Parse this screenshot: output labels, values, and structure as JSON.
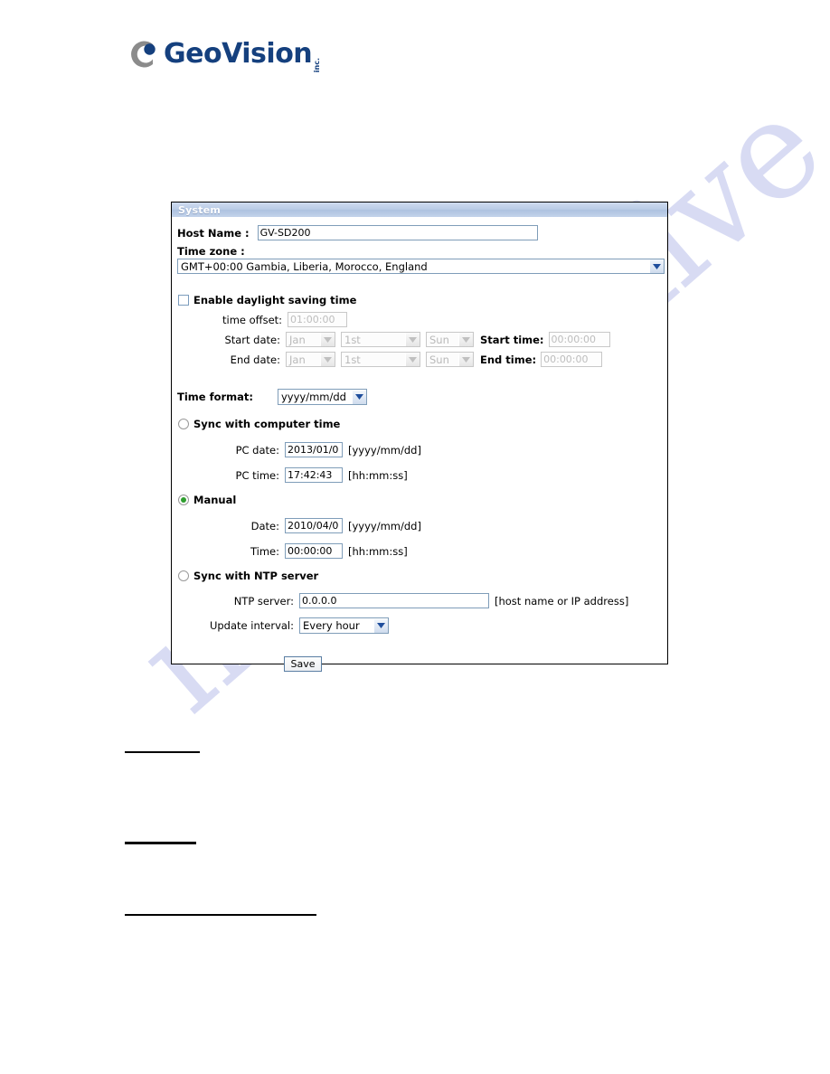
{
  "brand": {
    "name": "GeoVision",
    "suffix": "inc.",
    "logo_icon": "geovision-logo-icon",
    "color": "#15407e"
  },
  "watermark": {
    "text": "manualshive.com"
  },
  "panel": {
    "header_title": "System",
    "host_name": {
      "label": "Host Name :",
      "value": "GV-SD200"
    },
    "time_zone": {
      "label": "Time zone :",
      "value": "GMT+00:00 Gambia, Liberia, Morocco, England"
    },
    "daylight": {
      "label": "Enable daylight saving time",
      "checked": false,
      "time_offset_label": "time offset:",
      "time_offset_value": "01:00:00",
      "start_date_label": "Start date:",
      "end_date_label": "End date:",
      "start_time_label": "Start time:",
      "end_time_label": "End time:",
      "start_month": "Jan",
      "start_day": "1st",
      "start_weekday": "Sun",
      "end_month": "Jan",
      "end_day": "1st",
      "end_weekday": "Sun",
      "start_time_value": "00:00:00",
      "end_time_value": "00:00:00"
    },
    "time_format": {
      "label": "Time format:",
      "value": "yyyy/mm/dd"
    },
    "sync_computer": {
      "label": "Sync with computer time",
      "selected": false,
      "pc_date_label": "PC date:",
      "pc_date_value": "2013/01/0",
      "pc_date_hint": "[yyyy/mm/dd]",
      "pc_time_label": "PC time:",
      "pc_time_value": "17:42:43",
      "pc_time_hint": "[hh:mm:ss]"
    },
    "manual": {
      "label": "Manual",
      "selected": true,
      "date_label": "Date:",
      "date_value": "2010/04/0",
      "date_hint": "[yyyy/mm/dd]",
      "time_label": "Time:",
      "time_value": "00:00:00",
      "time_hint": "[hh:mm:ss]"
    },
    "sync_ntp": {
      "label": "Sync with NTP server",
      "selected": false,
      "server_label": "NTP server:",
      "server_value": "0.0.0.0",
      "server_hint": "[host name or IP address]",
      "interval_label": "Update interval:",
      "interval_value": "Every hour"
    },
    "save_label": "Save"
  }
}
